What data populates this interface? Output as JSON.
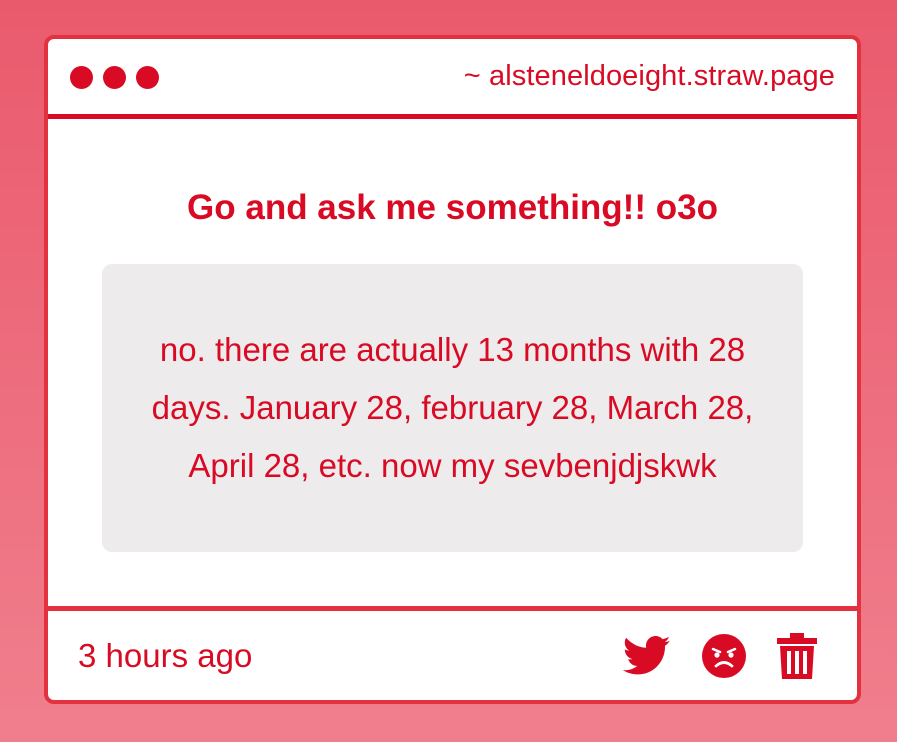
{
  "window": {
    "url": "~ alsteneldoeight.straw.page"
  },
  "question": {
    "heading": "Go and ask me something!! o3o"
  },
  "answer": {
    "text": "no. there are actually 13 months with 28 days. January 28, february 28, March 28, April 28, etc. now my sevbenjdjskwk"
  },
  "footer": {
    "timestamp": "3 hours ago",
    "actions": [
      {
        "icon": "twitter-icon"
      },
      {
        "icon": "angry-face-icon"
      },
      {
        "icon": "trash-icon"
      }
    ]
  },
  "colors": {
    "accent": "#d90a24",
    "border": "#e3313f",
    "answer_background": "#edebec",
    "page_gradient_top": "#ea5a6d",
    "page_gradient_bottom": "#f07f8d"
  }
}
